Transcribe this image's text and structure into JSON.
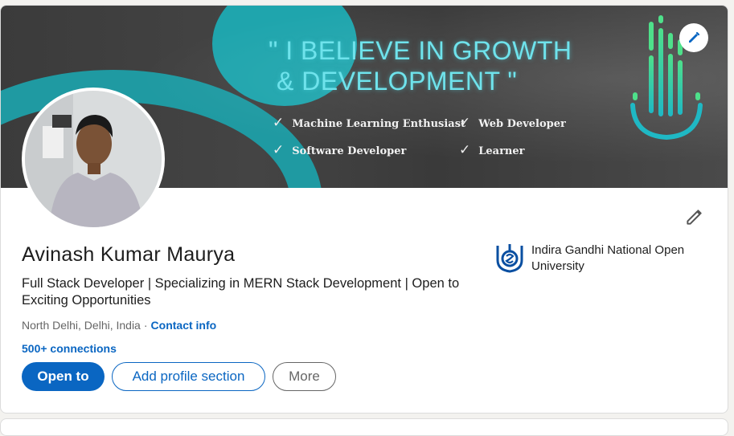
{
  "banner": {
    "quote_line1": "\" I BELIEVE IN GROWTH",
    "quote_line2": "& DEVELOPMENT \"",
    "bullets": [
      "Machine Learning Enthusiast",
      "Web Developer",
      "Software Developer",
      "Learner"
    ],
    "check_glyph": "✓"
  },
  "profile": {
    "name": "Avinash Kumar Maurya",
    "headline": "Full Stack Developer | Specializing in MERN Stack Development | Open to Exciting Opportunities",
    "location": "North Delhi, Delhi, India",
    "separator": "·",
    "contact_info": "Contact info",
    "connections": "500+ connections"
  },
  "actions": {
    "open_to": "Open to",
    "add_section": "Add profile section",
    "more": "More"
  },
  "education": {
    "name": "Indira Gandhi National Open University"
  },
  "icons": {
    "banner_edit": "pencil-icon",
    "intro_edit": "pencil-icon",
    "university_logo": "ignou-logo"
  },
  "colors": {
    "accent": "#0a66c2",
    "banner_teal": "#1fa5ad",
    "quote_text": "#6fe3ec"
  }
}
